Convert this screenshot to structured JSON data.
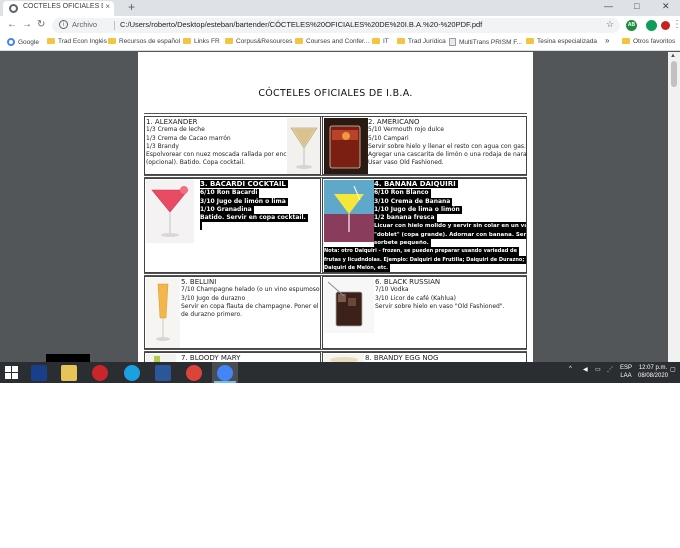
{
  "browser": {
    "tab_title": "CÓCTELES OFICIALES DE I.B.A. - ",
    "tab_close": "×",
    "new_tab": "+",
    "window_controls": {
      "minimize": "—",
      "maximize": "□",
      "close": "✕"
    },
    "nav": {
      "back": "←",
      "forward": "→",
      "reload": "↻"
    },
    "omnibox": {
      "info_icon": "i",
      "scheme": "Archivo",
      "url": "C:/Users/roberto/Desktop/esteban/bartender/CÓCTELES%20OFICIALES%20DE%20I.B.A.%20-%20PDF.pdf",
      "star": "☆"
    },
    "extensions": [
      {
        "label": "AB",
        "color": "#1e8e3e"
      },
      {
        "label": "",
        "color": "#0f9d58"
      },
      {
        "label": "",
        "color": "#c5221f"
      }
    ],
    "menu_dots": "⋮",
    "bookmarks": [
      {
        "label": "Google",
        "icon": "google-icon"
      },
      {
        "label": "Trad Econ Inglés",
        "icon": "folder-icon"
      },
      {
        "label": "Recursos de español",
        "icon": "folder-icon"
      },
      {
        "label": "Links FR",
        "icon": "folder-icon"
      },
      {
        "label": "Corpus&Resources",
        "icon": "folder-icon"
      },
      {
        "label": "Courses and Confer...",
        "icon": "folder-icon"
      },
      {
        "label": "IT",
        "icon": "folder-icon"
      },
      {
        "label": "Trad Jurídica",
        "icon": "folder-icon"
      },
      {
        "label": "MultiTrans PRISM F...",
        "icon": "page-icon"
      },
      {
        "label": "Tesina especializada",
        "icon": "folder-icon"
      }
    ],
    "bookmarks_overflow": "»",
    "other_bookmarks": "Otros favoritos"
  },
  "document": {
    "title": "CÓCTELES OFICIALES DE I.B.A.",
    "cocktails": [
      {
        "name": "1. ALEXANDER",
        "lines": [
          "1/3 Crema de leche",
          "1/3 Crema de Cacao marrón",
          "1/3 Brandy",
          "Espolvorear con nuez moscada rallada por encima",
          "(opcional). Batido. Copa cocktail."
        ],
        "highlighted": false
      },
      {
        "name": "2. AMERICANO",
        "lines": [
          "5/10 Vermouth rojo dulce",
          "5/10 Campari",
          "Servir sobre hielo y llenar el resto con agua con gas.",
          "Agregar una cascarita de limón o una rodaja de naranja.",
          "Usar vaso Old Fashioned."
        ],
        "highlighted": false
      },
      {
        "name": "3. BACARDI COCKTAIL",
        "lines": [
          "6/10 Ron Bacardi",
          "3/10 Jugo de limón o lima",
          "1/10 Granadina",
          "Batido. Servir en copa cocktail."
        ],
        "highlighted": true
      },
      {
        "name": "4. BANANA DAIQUIRI",
        "lines": [
          "6/10 Ron Blanco",
          "3/10 Crema de Banana",
          "1/10 Jugo de lima o limón",
          "1/2 banana fresca",
          "Licuar con hielo molido y servir sin colar en un vaso",
          "\"doblet\" (copa grande). Adornar con banana. Servir con",
          "sorbete pequeño.",
          "Nota: otro Daiquiri - frozen, se pueden preparar usando variedad de",
          "frutas y licudndolas. Ejemplo: Daiquiri de Frutilla; Daiquiri de Durazno;",
          "Daiquiri de Melón, etc."
        ],
        "highlighted": true
      },
      {
        "name": "5. BELLINI",
        "lines": [
          "7/10 Champagne helado (o un vino espumoso)",
          "3/10 Jugo de durazno",
          "Servir en copa flauta de champagne. Poner el jugo",
          "de durazno primero."
        ],
        "highlighted": false
      },
      {
        "name": "6. BLACK RUSSIAN",
        "lines": [
          "7/10 Vodka",
          "3/10 Licor de café (Kahlua)",
          "Servir sobre hielo en vaso \"Old Fashioned\"."
        ],
        "highlighted": false
      },
      {
        "name": "7. BLOODY MARY",
        "lines": [],
        "highlighted": false
      },
      {
        "name": "8. BRANDY EGG NOG",
        "lines": [],
        "highlighted": false
      }
    ]
  },
  "taskbar": {
    "start_icon": "windows-start-icon",
    "apps": [
      "lec-app",
      "file-explorer",
      "r-app",
      "internet-explorer",
      "word",
      "chrome",
      "chrome-active"
    ],
    "tray": {
      "chevron": "^",
      "lang_top": "ESP",
      "lang_bottom": "LAA",
      "time": "12:07 p.m.",
      "date": "08/08/2020"
    }
  }
}
